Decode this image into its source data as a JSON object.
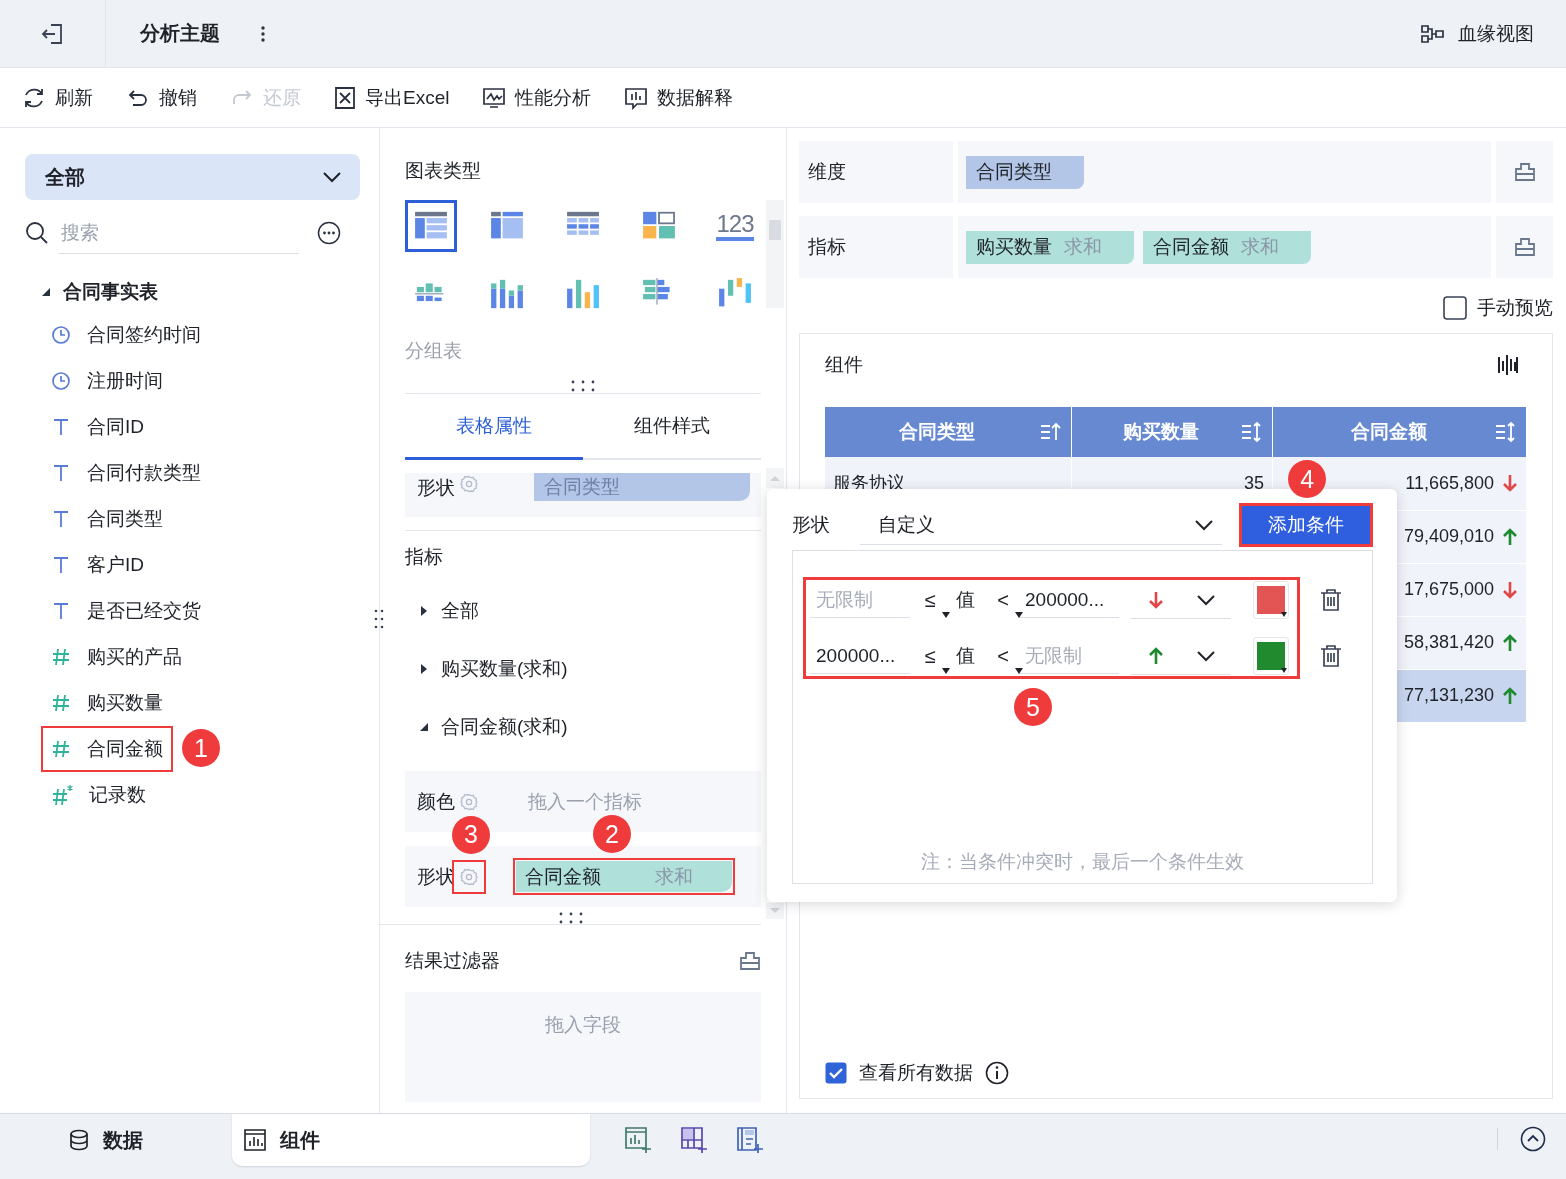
{
  "header": {
    "title": "分析主题",
    "lineage_button": "血缘视图"
  },
  "toolbar": [
    {
      "label": "刷新",
      "disabled": false
    },
    {
      "label": "撤销",
      "disabled": false
    },
    {
      "label": "还原",
      "disabled": true
    },
    {
      "label": "导出Excel",
      "disabled": false
    },
    {
      "label": "性能分析",
      "disabled": false
    },
    {
      "label": "数据解释",
      "disabled": false
    }
  ],
  "field_panel": {
    "scope": "全部",
    "search": {
      "placeholder": "搜索"
    },
    "tree": [
      {
        "label": "合同事实表",
        "expanded": true,
        "children": [
          {
            "label": "合同签约时间",
            "kind": "date",
            "highlighted": false
          },
          {
            "label": "注册时间",
            "kind": "date",
            "highlighted": false
          },
          {
            "label": "合同ID",
            "kind": "text",
            "highlighted": false
          },
          {
            "label": "合同付款类型",
            "kind": "text",
            "highlighted": false
          },
          {
            "label": "合同类型",
            "kind": "text",
            "highlighted": false
          },
          {
            "label": "客户ID",
            "kind": "text",
            "highlighted": false
          },
          {
            "label": "是否已经交货",
            "kind": "text",
            "highlighted": false
          },
          {
            "label": "购买的产品",
            "kind": "number",
            "highlighted": false
          },
          {
            "label": "购买数量",
            "kind": "number",
            "highlighted": false
          },
          {
            "label": "合同金额",
            "kind": "number",
            "highlighted": true,
            "badge": "1"
          },
          {
            "label": "记录数",
            "kind": "count",
            "highlighted": false
          }
        ]
      }
    ]
  },
  "chart_panel": {
    "title": "图表类型",
    "chart_types": [
      {
        "kind": "grouped",
        "selected": true
      },
      {
        "kind": "pivot",
        "selected": false
      },
      {
        "kind": "detail",
        "selected": false
      },
      {
        "kind": "tile",
        "selected": false
      },
      {
        "kind": "kpi",
        "label": "123",
        "selected": false
      },
      {
        "kind": "diverging",
        "selected": false
      },
      {
        "kind": "stacked",
        "selected": false
      },
      {
        "kind": "column",
        "selected": false
      },
      {
        "kind": "hbar",
        "selected": false
      },
      {
        "kind": "waterfall",
        "selected": false
      }
    ],
    "selected_type_name": "分组表",
    "tabs": [
      {
        "label": "表格属性",
        "selected": true
      },
      {
        "label": "组件样式",
        "selected": false
      }
    ],
    "dimension_shape": {
      "label": "形状",
      "chip": "合同类型"
    },
    "measures_title": "指标",
    "measures": [
      {
        "label": "全部",
        "expanded": false
      },
      {
        "label": "购买数量(求和)",
        "expanded": false
      },
      {
        "label": "合同金额(求和)",
        "expanded": true
      }
    ],
    "color_slot": {
      "label": "颜色",
      "placeholder": "拖入一个指标"
    },
    "shape_slot": {
      "label": "形状",
      "field": "合同金额",
      "aggregation": "求和",
      "gear_highlighted": true,
      "gear_badge": "3",
      "chip_highlighted": true,
      "chip_badge": "2"
    },
    "result_filter": {
      "title": "结果过滤器",
      "placeholder": "拖入字段"
    }
  },
  "config_panel": {
    "dimension": {
      "label": "维度",
      "chips": [
        {
          "field": "合同类型"
        }
      ]
    },
    "measure": {
      "label": "指标",
      "chips": [
        {
          "field": "购买数量",
          "aggregation": "求和"
        },
        {
          "field": "合同金额",
          "aggregation": "求和"
        }
      ]
    },
    "manual_preview": {
      "label": "手动预览",
      "checked": false
    },
    "widget": {
      "title": "组件",
      "columns": [
        {
          "label": "合同类型",
          "sorted_ascending": true
        },
        {
          "label": "购买数量",
          "sorted_ascending": false
        },
        {
          "label": "合同金额",
          "sorted_ascending": false
        }
      ],
      "rows": [
        {
          "type": "服务协议",
          "quantity": "35",
          "amount": "11,665,800",
          "rising": false,
          "selected": false
        },
        {
          "amount": "79,409,010",
          "rising": true,
          "selected": false
        },
        {
          "amount": "17,675,000",
          "rising": false,
          "selected": false
        },
        {
          "amount": "58,381,420",
          "rising": true,
          "selected": false
        },
        {
          "amount": "77,131,230",
          "rising": true,
          "selected": true
        }
      ]
    },
    "view_all": {
      "label": "查看所有数据",
      "checked": true
    }
  },
  "shape_popup": {
    "label": "形状",
    "mode": "自定义",
    "add_button": {
      "label": "添加条件",
      "highlighted": true,
      "badge": "4"
    },
    "conditions_highlighted": true,
    "conditions_badge": "5",
    "conditions": [
      {
        "min": {
          "placeholder": "无限制"
        },
        "lower_op": "≤",
        "value_label": "值",
        "upper_op": "<",
        "max": {
          "value": "200000..."
        },
        "rising": false,
        "color": "#e35454"
      },
      {
        "min": {
          "value": "200000..."
        },
        "lower_op": "≤",
        "value_label": "值",
        "upper_op": "<",
        "max": {
          "placeholder": "无限制"
        },
        "rising": true,
        "color": "#218a2e"
      }
    ],
    "note": "注：当条件冲突时，最后一个条件生效"
  },
  "bottom_bar": {
    "tabs": [
      {
        "label": "数据",
        "selected": false
      },
      {
        "label": "组件",
        "selected": true
      }
    ]
  }
}
